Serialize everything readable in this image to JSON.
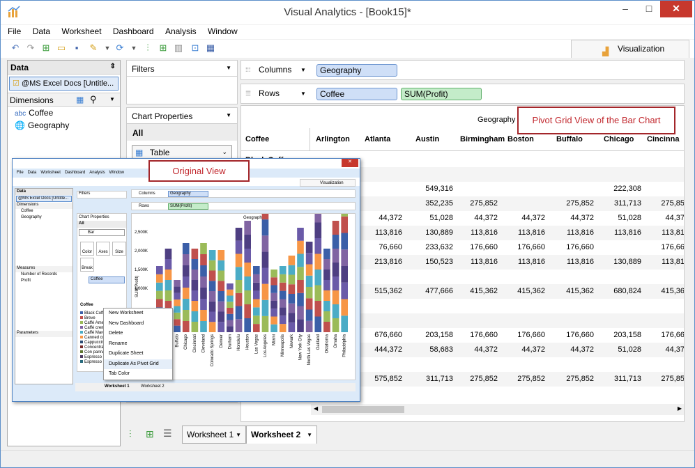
{
  "window": {
    "title": "Visual Analytics - [Book15]*",
    "min": "–",
    "max": "□",
    "close": "✕"
  },
  "menu": [
    "File",
    "Data",
    "Worksheet",
    "Dashboard",
    "Analysis",
    "Window"
  ],
  "viz_tab": "Visualization",
  "data_pane": {
    "title": "Data",
    "source": "@MS Excel Docs [Untitle...",
    "dimensions_label": "Dimensions",
    "fields": [
      "Coffee",
      "Geography"
    ],
    "field_prefix": "abc"
  },
  "filters": {
    "title": "Filters"
  },
  "chart_properties": {
    "title": "Chart Properties",
    "all": "All",
    "chart_type": "Table"
  },
  "columns": {
    "label": "Columns",
    "pill": "Geography"
  },
  "rows": {
    "label": "Rows",
    "pills": [
      "Coffee",
      "SUM(Profit)"
    ]
  },
  "grid": {
    "top_header": "Geography",
    "row_header": "Coffee",
    "first_row": "Black Coffee",
    "cities": [
      "Arlington",
      "Atlanta",
      "Austin",
      "Birmingham",
      "Boston",
      "Buffalo",
      "Chicago",
      "Cincinna"
    ],
    "rows": [
      [
        "",
        "",
        "549,316",
        "",
        "",
        "",
        "222,308",
        ""
      ],
      [
        "",
        "",
        "352,235",
        "275,852",
        "",
        "275,852",
        "311,713",
        "275,85"
      ],
      [
        "",
        "44,372",
        "51,028",
        "44,372",
        "44,372",
        "44,372",
        "51,028",
        "44,37"
      ],
      [
        "",
        "113,816",
        "130,889",
        "113,816",
        "113,816",
        "113,816",
        "113,816",
        "113,81"
      ],
      [
        "",
        "76,660",
        "233,632",
        "176,660",
        "176,660",
        "176,660",
        "",
        "176,66"
      ],
      [
        "",
        "213,816",
        "150,523",
        "113,816",
        "113,816",
        "113,816",
        "130,889",
        "113,81"
      ],
      [
        "",
        "",
        "",
        " ",
        "",
        "",
        "",
        ""
      ],
      [
        "",
        "515,362",
        "477,666",
        "415,362",
        "415,362",
        "415,362",
        "680,824",
        "415,36"
      ],
      [
        "",
        "",
        "",
        " ",
        "",
        "",
        "",
        ""
      ],
      [
        "",
        "",
        "",
        " ",
        "",
        "",
        "",
        ""
      ],
      [
        "",
        "676,660",
        "203,158",
        "176,660",
        "176,660",
        "176,660",
        "203,158",
        "176,66"
      ],
      [
        "",
        "444,372",
        "58,683",
        "44,372",
        "44,372",
        "44,372",
        "51,028",
        "44,37"
      ],
      [
        "",
        "",
        "",
        " ",
        "",
        "",
        "",
        ""
      ],
      [
        "",
        "575,852",
        "311,713",
        "275,852",
        "275,852",
        "275,852",
        "311,713",
        "275,85"
      ]
    ]
  },
  "callouts": {
    "pivot": "Pivot Grid View of the Bar Chart",
    "original": "Original View"
  },
  "worksheets": [
    "Worksheet 1",
    "Worksheet 2"
  ],
  "inset": {
    "menu": [
      "File",
      "Data",
      "Worksheet",
      "Dashboard",
      "Analysis",
      "Window"
    ],
    "viz_tab": "Visualization",
    "data_title": "Data",
    "source": "@MS Excel Docs [Untitle...",
    "dims": "Dimensions",
    "fields": [
      "Coffee",
      "Geography"
    ],
    "measures_title": "Measures",
    "measures": [
      "Number of Records",
      "Profit"
    ],
    "parameters": "Parameters",
    "filters": "Filters",
    "chart_props": "Chart Properties",
    "all": "All",
    "type": "Bar",
    "buttons": [
      "Color",
      "Axes",
      "Size",
      "Break"
    ],
    "color_field": "Coffee",
    "columns": "Columns",
    "col_pill": "Geography",
    "rows": "Rows",
    "row_pill": "SUM(Profit)",
    "chart_title": "Geography",
    "ylabel": "SUM(Profit)",
    "yticks": [
      "2,500K",
      "2,000K",
      "1,500K",
      "1,000K"
    ],
    "legend_title": "Coffee",
    "legend": [
      "Black Coffee",
      "Breve",
      "Caffé Amer",
      "Caffé crem",
      "Caffé Maro",
      "Canned cof",
      "Cappuccino",
      "Concentrat",
      "Con panna",
      "Espresso",
      "Espresso"
    ],
    "cities": [
      "Birmingham",
      "Boston",
      "Buffalo",
      "Chicago",
      "Cincinnati",
      "Cleveland",
      "Colorado Springs",
      "Denver",
      "Durham",
      "Honolulu",
      "Houston",
      "Las Vegas",
      "Los Angeles",
      "Miami",
      "Minneapolis",
      "Newark",
      "New York City",
      "North Las Vegas",
      "Oakland",
      "Oklahoma",
      "Omaha",
      "Philadelphia"
    ],
    "context_menu": [
      "New Worksheet",
      "New Dashboard",
      "Delete",
      "Rename",
      "Duplicate Sheet",
      "Duplicate As Pivot Grid",
      "Tab Color"
    ],
    "tabs": [
      "Worksheet 1",
      "Worksheet 2"
    ]
  }
}
